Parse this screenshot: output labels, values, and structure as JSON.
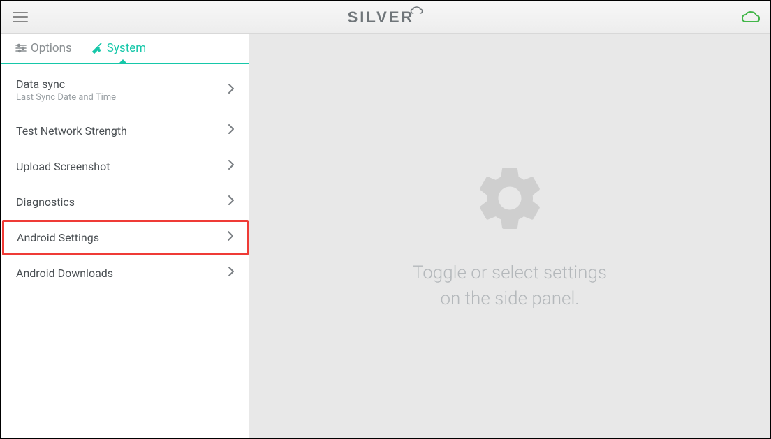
{
  "header": {
    "logo_text": "SILVER"
  },
  "tabs": {
    "options_label": "Options",
    "system_label": "System",
    "active": "system"
  },
  "sidebar": {
    "items": [
      {
        "label": "Data sync",
        "sublabel": "Last Sync Date and Time",
        "highlighted": false
      },
      {
        "label": "Test Network Strength",
        "sublabel": null,
        "highlighted": false
      },
      {
        "label": "Upload Screenshot",
        "sublabel": null,
        "highlighted": false
      },
      {
        "label": "Diagnostics",
        "sublabel": null,
        "highlighted": false
      },
      {
        "label": "Android Settings",
        "sublabel": null,
        "highlighted": true
      },
      {
        "label": "Android Downloads",
        "sublabel": null,
        "highlighted": false
      }
    ]
  },
  "main": {
    "placeholder_line1": "Toggle or select settings",
    "placeholder_line2": "on the side panel."
  },
  "colors": {
    "accent": "#16c7a9",
    "highlight": "#ef3b36",
    "cloud_status": "#42b649"
  }
}
